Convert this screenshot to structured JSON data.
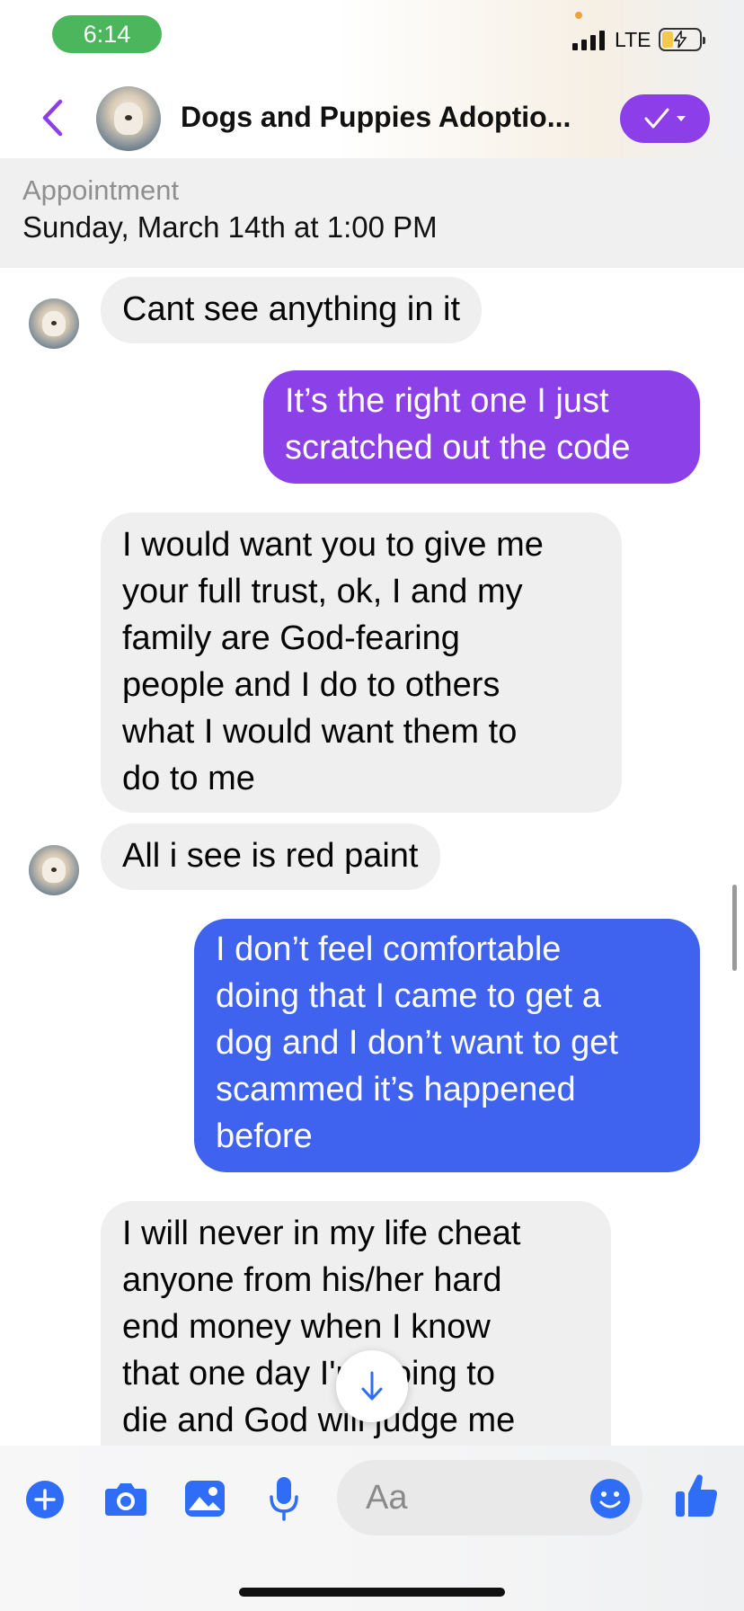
{
  "status_bar": {
    "time": "6:14",
    "network": "LTE"
  },
  "header": {
    "title": "Dogs  and Puppies  Adoptio...",
    "back_icon": "chevron-left-icon",
    "verify_icon": "checkmark-dropdown-icon"
  },
  "appointment": {
    "label": "Appointment",
    "value": "Sunday, March 14th at 1:00 PM"
  },
  "messages": [
    {
      "direction": "incoming",
      "lines": [
        "Cant see anything in it"
      ]
    },
    {
      "direction": "outgoing",
      "lines": [
        "It’s the right one I just",
        "scratched out the code"
      ]
    },
    {
      "direction": "incoming",
      "lines": [
        "I would want you to give me",
        "your full trust, ok, I and my",
        "family are God-fearing",
        "people and I do to others",
        "what I would want them to",
        "do to me"
      ]
    },
    {
      "direction": "incoming",
      "lines": [
        "All i see is red paint"
      ]
    },
    {
      "direction": "outgoing",
      "lines": [
        "I don’t feel comfortable",
        "doing that I came to get a",
        "dog and I don’t want to get",
        "scammed it’s happened",
        "before"
      ]
    },
    {
      "direction": "incoming",
      "lines": [
        "I will never in my life cheat",
        "anyone from his/her hard",
        "end money when I know",
        "that one day I'm going to",
        "die and God will judge me"
      ]
    }
  ],
  "composer": {
    "placeholder": "Aa",
    "icons": [
      "plus-icon",
      "camera-icon",
      "image-icon",
      "microphone-icon",
      "emoji-icon",
      "thumbs-up-icon"
    ]
  },
  "colors": {
    "outgoing_purple": "#8b40e8",
    "outgoing_blue": "#3f63ee",
    "incoming_bg": "#efefef",
    "accent": "#2f6df6",
    "brand_purple": "#8c3ee8"
  }
}
